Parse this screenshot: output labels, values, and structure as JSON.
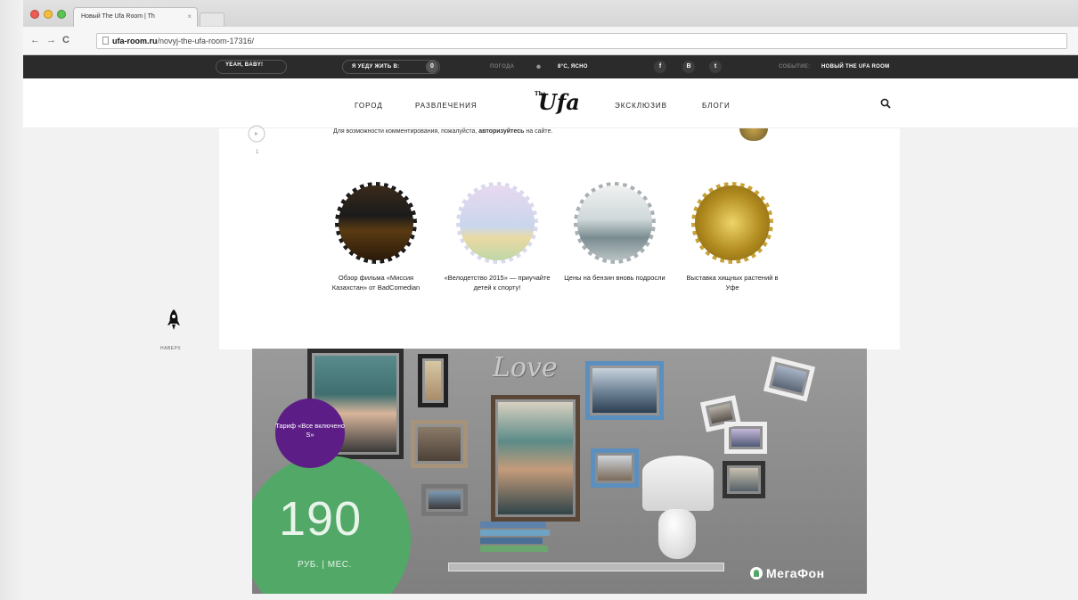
{
  "browser": {
    "tab_title": "Новый The Ufa Room | Th",
    "tab_close": "×",
    "url_domain": "ufa-room.ru",
    "url_path": "/novyj-the-ufa-room-17316/"
  },
  "topbar": {
    "yeah": "YEAH, BABY!",
    "cta": "Я УЕДУ ЖИТЬ В:",
    "cta_icon": "0",
    "weather_label": "ПОГОДА",
    "weather_value": "8°C, ЯСНО",
    "social": [
      "f",
      "B",
      "t"
    ],
    "event_label": "СОБЫТИЕ:",
    "event_value": "НОВЫЙ THE UFA ROOM"
  },
  "header": {
    "nav_left": [
      "ГОРОД",
      "РАЗВЛЕЧЕНИЯ"
    ],
    "logo": "Ufa",
    "logo_small": "The",
    "nav_right": [
      "ЭКСКЛЮЗИВ",
      "БЛОГИ"
    ]
  },
  "comments": {
    "text_before": "Для возможности комментирования, пожалуйста, ",
    "link": "авторизуйтесь",
    "text_after": " на сайте.",
    "count": "1"
  },
  "related": [
    {
      "title": "Обзор фильма «Миссия Казахстан» от BadComedian",
      "color": "#1b1b1b"
    },
    {
      "title": "«Велодетство 2015» — приучайте детей к спорту!",
      "color": "#d9d9ee"
    },
    {
      "title": "Цены на бензин вновь подросли",
      "color": "#a9b0b3"
    },
    {
      "title": "Выставка хищных растений в Уфе",
      "color": "#c7a23b"
    }
  ],
  "sidebar": {
    "rocket_label": "НАВЕРХ"
  },
  "ad": {
    "love": "Love",
    "plan_name": "Тариф «Все включено S»",
    "price": "190",
    "price_unit": "РУБ. | МЕС.",
    "brand": "МегаФон",
    "colors": {
      "green": "#52a866",
      "purple": "#5c1e86"
    }
  }
}
